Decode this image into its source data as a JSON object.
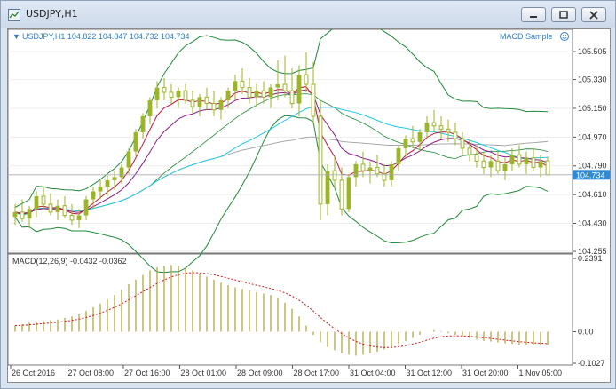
{
  "window": {
    "title": "USDJPY,H1",
    "buttons": [
      "minimize",
      "restore",
      "close"
    ]
  },
  "colors": {
    "candle": "#9ab624",
    "price_panel_text": "#2f7ec8",
    "axis_text": "#333333",
    "bollinger": "#1f8a3a",
    "ma_fast": "#c0143c",
    "ma_slow": "#8c1a8c",
    "ma_cyan": "#22c8e6",
    "ma_gray": "#a0a0a0",
    "macd_hist": "#b5a840",
    "macd_signal": "#d01818",
    "current_price_bg": "#2e8ad6"
  },
  "chart": {
    "info": "USDJPY,H1  104.822 104.847 104.732 104.734",
    "expert": "MACD Sample",
    "current_price": "104.734",
    "price_ticks": [
      "105.505",
      "105.330",
      "105.150",
      "104.970",
      "104.790",
      "104.610",
      "104.430",
      "104.255"
    ],
    "time_labels": [
      "26 Oct 2016",
      "27 Oct 08:00",
      "27 Oct 16:00",
      "28 Oct 01:00",
      "28 Oct 09:00",
      "28 Oct 17:00",
      "31 Oct 04:00",
      "31 Oct 12:00",
      "31 Oct 20:00",
      "1 Nov 05:00"
    ]
  },
  "macd": {
    "label": "MACD(12,26,9) -0.0432 -0.0362",
    "ticks": [
      "0.2391",
      "0.00",
      "-0.1027"
    ]
  },
  "chart_data": [
    {
      "type": "candlestick",
      "title": "USDJPY,H1",
      "ylim": [
        104.255,
        105.6
      ],
      "ohlc": [
        [
          104.47,
          104.55,
          104.42,
          104.5
        ],
        [
          104.5,
          104.58,
          104.44,
          104.46
        ],
        [
          104.46,
          104.54,
          104.4,
          104.52
        ],
        [
          104.52,
          104.63,
          104.47,
          104.6
        ],
        [
          104.6,
          104.66,
          104.52,
          104.55
        ],
        [
          104.55,
          104.62,
          104.48,
          104.5
        ],
        [
          104.5,
          104.58,
          104.45,
          104.54
        ],
        [
          104.54,
          104.6,
          104.46,
          104.48
        ],
        [
          104.48,
          104.55,
          104.42,
          104.45
        ],
        [
          104.45,
          104.52,
          104.4,
          104.48
        ],
        [
          104.48,
          104.6,
          104.45,
          104.58
        ],
        [
          104.58,
          104.66,
          104.52,
          104.63
        ],
        [
          104.63,
          104.7,
          104.58,
          104.66
        ],
        [
          104.66,
          104.74,
          104.6,
          104.7
        ],
        [
          104.7,
          104.76,
          104.64,
          104.72
        ],
        [
          104.72,
          104.8,
          104.68,
          104.78
        ],
        [
          104.78,
          104.9,
          104.74,
          104.88
        ],
        [
          104.88,
          105.02,
          104.85,
          105.0
        ],
        [
          105.0,
          105.12,
          104.96,
          105.1
        ],
        [
          105.1,
          105.22,
          105.05,
          105.2
        ],
        [
          105.2,
          105.32,
          105.15,
          105.28
        ],
        [
          105.28,
          105.34,
          105.2,
          105.25
        ],
        [
          105.25,
          105.3,
          105.18,
          105.22
        ],
        [
          105.22,
          105.28,
          105.15,
          105.26
        ],
        [
          105.26,
          105.3,
          105.18,
          105.2
        ],
        [
          105.2,
          105.26,
          105.12,
          105.16
        ],
        [
          105.16,
          105.24,
          105.1,
          105.22
        ],
        [
          105.22,
          105.28,
          105.14,
          105.18
        ],
        [
          105.18,
          105.26,
          105.1,
          105.14
        ],
        [
          105.14,
          105.22,
          105.08,
          105.2
        ],
        [
          105.2,
          105.28,
          105.15,
          105.26
        ],
        [
          105.26,
          105.36,
          105.2,
          105.32
        ],
        [
          105.32,
          105.4,
          105.24,
          105.28
        ],
        [
          105.28,
          105.34,
          105.18,
          105.22
        ],
        [
          105.22,
          105.3,
          105.16,
          105.26
        ],
        [
          105.26,
          105.32,
          105.18,
          105.22
        ],
        [
          105.22,
          105.3,
          105.15,
          105.28
        ],
        [
          105.28,
          105.45,
          105.2,
          105.3
        ],
        [
          105.3,
          105.48,
          105.22,
          105.26
        ],
        [
          105.26,
          105.4,
          105.15,
          105.18
        ],
        [
          105.18,
          105.42,
          105.1,
          105.36
        ],
        [
          105.36,
          105.5,
          105.25,
          105.3
        ],
        [
          105.3,
          105.44,
          105.05,
          105.1
        ],
        [
          105.1,
          105.2,
          104.45,
          104.55
        ],
        [
          104.55,
          104.8,
          104.48,
          104.76
        ],
        [
          104.76,
          104.85,
          104.65,
          104.7
        ],
        [
          104.7,
          104.78,
          104.48,
          104.52
        ],
        [
          104.52,
          104.74,
          104.5,
          104.72
        ],
        [
          104.72,
          104.82,
          104.66,
          104.8
        ],
        [
          104.8,
          104.88,
          104.72,
          104.76
        ],
        [
          104.76,
          104.82,
          104.68,
          104.78
        ],
        [
          104.78,
          104.86,
          104.72,
          104.74
        ],
        [
          104.74,
          104.8,
          104.66,
          104.7
        ],
        [
          104.7,
          104.82,
          104.66,
          104.8
        ],
        [
          104.8,
          104.92,
          104.76,
          104.9
        ],
        [
          104.9,
          104.98,
          104.84,
          104.96
        ],
        [
          104.96,
          105.04,
          104.9,
          104.94
        ],
        [
          104.94,
          105.02,
          104.88,
          105.0
        ],
        [
          105.0,
          105.1,
          104.96,
          105.06
        ],
        [
          105.06,
          105.14,
          105.0,
          105.04
        ],
        [
          105.04,
          105.1,
          104.96,
          105.02
        ],
        [
          105.02,
          105.08,
          104.94,
          105.0
        ],
        [
          105.0,
          105.06,
          104.92,
          104.96
        ],
        [
          104.96,
          105.0,
          104.86,
          104.9
        ],
        [
          104.9,
          104.96,
          104.82,
          104.86
        ],
        [
          104.86,
          104.92,
          104.78,
          104.82
        ],
        [
          104.82,
          104.88,
          104.74,
          104.78
        ],
        [
          104.78,
          104.86,
          104.72,
          104.82
        ],
        [
          104.82,
          104.88,
          104.74,
          104.76
        ],
        [
          104.76,
          104.84,
          104.7,
          104.8
        ],
        [
          104.8,
          104.9,
          104.76,
          104.86
        ],
        [
          104.86,
          104.92,
          104.78,
          104.8
        ],
        [
          104.8,
          104.88,
          104.74,
          104.84
        ],
        [
          104.84,
          104.9,
          104.76,
          104.78
        ],
        [
          104.78,
          104.86,
          104.72,
          104.82
        ],
        [
          104.822,
          104.847,
          104.732,
          104.734
        ]
      ]
    },
    {
      "type": "bar",
      "title": "MACD(12,26,9) -0.0432 -0.0362",
      "ylim": [
        -0.1027,
        0.2391
      ],
      "values": [
        0.02,
        0.025,
        0.03,
        0.032,
        0.035,
        0.038,
        0.04,
        0.045,
        0.05,
        0.058,
        0.068,
        0.08,
        0.092,
        0.105,
        0.12,
        0.138,
        0.155,
        0.17,
        0.185,
        0.2,
        0.21,
        0.215,
        0.218,
        0.215,
        0.21,
        0.2,
        0.19,
        0.18,
        0.17,
        0.16,
        0.152,
        0.145,
        0.14,
        0.135,
        0.13,
        0.125,
        0.12,
        0.11,
        0.095,
        0.075,
        0.05,
        0.02,
        -0.01,
        -0.035,
        -0.05,
        -0.06,
        -0.07,
        -0.075,
        -0.078,
        -0.075,
        -0.07,
        -0.065,
        -0.058,
        -0.05,
        -0.04,
        -0.03,
        -0.02,
        -0.01,
        0.0,
        0.005,
        0.002,
        -0.005,
        -0.01,
        -0.015,
        -0.02,
        -0.025,
        -0.03,
        -0.032,
        -0.035,
        -0.038,
        -0.04,
        -0.042,
        -0.043,
        -0.043,
        -0.043,
        -0.0432
      ],
      "signal": "-0.0362"
    }
  ]
}
